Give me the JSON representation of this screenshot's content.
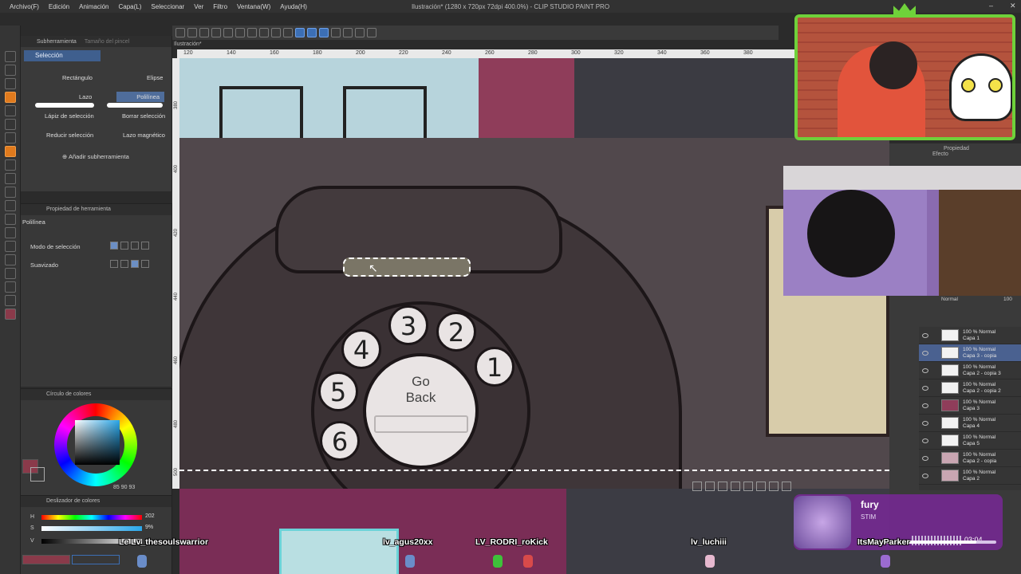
{
  "app": {
    "window_title": "Ilustración* (1280 x 720px 72dpi 400.0%) - CLIP STUDIO PAINT PRO",
    "doc_tab": "Ilustración*"
  },
  "menu": [
    "Archivo(F)",
    "Edición",
    "Animación",
    "Capa(L)",
    "Seleccionar",
    "Ver",
    "Filtro",
    "Ventana(W)",
    "Ayuda(H)"
  ],
  "subtool_panel": {
    "tabs": [
      "Subherramienta",
      "Tamaño del pincel"
    ],
    "group": "Selección",
    "tools": {
      "rectangle": "Rectángulo",
      "ellipse": "Elipse",
      "lasso": "Lazo",
      "polyline": "Polilínea",
      "selection_pen": "Lápiz de selección",
      "erase_selection": "Borrar selección",
      "shrink_selection": "Reducir selección",
      "magnetic_lasso": "Lazo magnético"
    },
    "add_subtool": "Añadir subherramienta"
  },
  "tool_property": {
    "title": "Propiedad de herramienta",
    "tool_name": "Polilínea",
    "rows": [
      "Modo de selección",
      "Suavizado"
    ]
  },
  "color_wheel": {
    "title": "Círculo de colores",
    "h": "85",
    "s": "90",
    "v": "93",
    "main_color": "#8a3a4a"
  },
  "color_slider": {
    "title": "Deslizador de colores",
    "h_label": "H",
    "s_label": "S",
    "v_label": "V",
    "h_value": "202",
    "s_value": "9%"
  },
  "ruler": {
    "top_ticks": [
      "120",
      "140",
      "160",
      "180",
      "200",
      "220",
      "240",
      "260",
      "280",
      "300",
      "320",
      "340",
      "360",
      "380"
    ],
    "left_ticks": [
      "380",
      "400",
      "420",
      "440",
      "460",
      "480",
      "500"
    ]
  },
  "canvas": {
    "digits": [
      "1",
      "2",
      "3",
      "4",
      "5",
      "6"
    ],
    "dial_text_1": "Go",
    "dial_text_2": "Back"
  },
  "right_panel": {
    "tabs": [
      "Propiedad",
      "Efecto"
    ],
    "layers": [
      {
        "mode": "100 % Normal",
        "name": "Capa 1",
        "selected": false
      },
      {
        "mode": "100 % Normal",
        "name": "Capa 3 - copia",
        "selected": true
      },
      {
        "mode": "100 % Normal",
        "name": "Capa 2 - copia 3",
        "selected": false
      },
      {
        "mode": "100 % Normal",
        "name": "Capa 2 - copia 2",
        "selected": false
      },
      {
        "mode": "100 % Normal",
        "name": "Capa 3",
        "selected": false
      },
      {
        "mode": "100 % Normal",
        "name": "Capa 4",
        "selected": false
      },
      {
        "mode": "100 % Normal",
        "name": "Capa 5",
        "selected": false
      },
      {
        "mode": "100 % Normal",
        "name": "Capa 2 - copia",
        "selected": false
      },
      {
        "mode": "100 % Normal",
        "name": "Capa 2",
        "selected": false
      }
    ],
    "blend_mode": "Normal",
    "opacity": "100"
  },
  "music": {
    "track": "fury",
    "artist": "STIM",
    "time": "03:04",
    "progress": 0.85
  },
  "chat_viewers": [
    "Le Lv_thesoulswarrior",
    "lv_agus20xx",
    "LV_RODRI_roKick",
    "lv_luchiii",
    "ItsMayParker"
  ],
  "colors": {
    "accent": "#3c6fb5",
    "active_tool": "#e07a1d",
    "webcam_border": "#6fd13a"
  }
}
